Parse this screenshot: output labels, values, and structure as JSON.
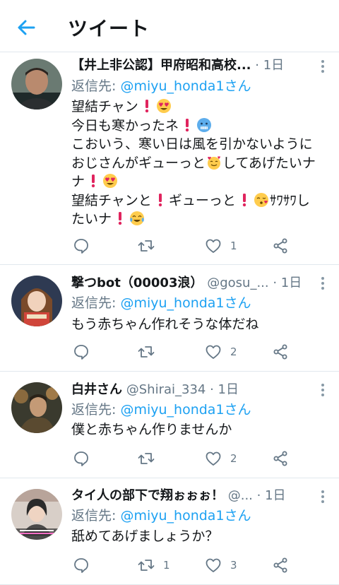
{
  "header": {
    "title": "ツイート"
  },
  "tweets": [
    {
      "name": "【井上非公認】甲府昭和高校...",
      "handle": "",
      "time": "1日",
      "reply_prefix": "返信先: ",
      "reply_to": "@miyu_honda1さん",
      "lines": [
        "望結チャン",
        "今日も寒かったネ",
        "こおいう、寒い日は風を引かないように",
        "おじさんがギューっと",
        "してあげたいナ",
        "ナ",
        "望結チャンと",
        "ギューっと",
        "ｻﾜｻﾜし",
        "たいナ"
      ],
      "counts": {
        "reply": "",
        "retweet": "",
        "like": "1"
      },
      "avatar_colors": [
        "#6a7a72",
        "#2b2420"
      ]
    },
    {
      "name": "撃つbot（00003浪）",
      "handle": "@gosu_...",
      "time": "1日",
      "reply_prefix": "返信先: ",
      "reply_to": "@miyu_honda1さん",
      "lines": [
        "もう赤ちゃん作れそうな体だね"
      ],
      "counts": {
        "reply": "",
        "retweet": "",
        "like": "2"
      },
      "avatar_colors": [
        "#7a4a2a",
        "#d0453a"
      ]
    },
    {
      "name": "白井さん",
      "handle": "@Shirai_334",
      "time": "1日",
      "reply_prefix": "返信先: ",
      "reply_to": "@miyu_honda1さん",
      "lines": [
        "僕と赤ちゃん作りませんか"
      ],
      "counts": {
        "reply": "",
        "retweet": "",
        "like": "2"
      },
      "avatar_colors": [
        "#3a3a2e",
        "#8a6a3e"
      ]
    },
    {
      "name": "タイ人の部下で翔ぉぉぉ！",
      "handle": "@...",
      "time": "1日",
      "reply_prefix": "返信先: ",
      "reply_to": "@miyu_honda1さん",
      "lines": [
        "舐めてあげましょうか？"
      ],
      "counts": {
        "reply": "",
        "retweet": "1",
        "like": "3"
      },
      "avatar_colors": [
        "#b8a49a",
        "#2a2a2a"
      ]
    }
  ],
  "colors": {
    "accent": "#1da1f2",
    "muted": "#657786",
    "text": "#14171a",
    "divider": "#e1e8ed",
    "emoji_mark": "#e0245e"
  }
}
